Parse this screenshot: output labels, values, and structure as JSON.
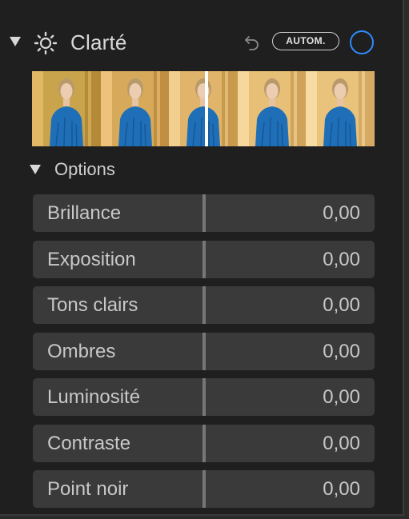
{
  "header": {
    "title": "Clarté",
    "auto_label": "AUTOM.",
    "icons": {
      "disclosure": "triangle-down-icon",
      "adjustment": "sun-icon",
      "undo": "undo-arrow-icon",
      "toggle": "circle-toggle-icon"
    },
    "accent_color": "#2f8cff"
  },
  "thumbnail_strip": {
    "frames": 5,
    "handle": "strip-handle"
  },
  "options": {
    "label": "Options",
    "sliders": [
      {
        "label": "Brillance",
        "value": "0,00"
      },
      {
        "label": "Exposition",
        "value": "0,00"
      },
      {
        "label": "Tons clairs",
        "value": "0,00"
      },
      {
        "label": "Ombres",
        "value": "0,00"
      },
      {
        "label": "Luminosité",
        "value": "0,00"
      },
      {
        "label": "Contraste",
        "value": "0,00"
      },
      {
        "label": "Point noir",
        "value": "0,00"
      }
    ]
  }
}
